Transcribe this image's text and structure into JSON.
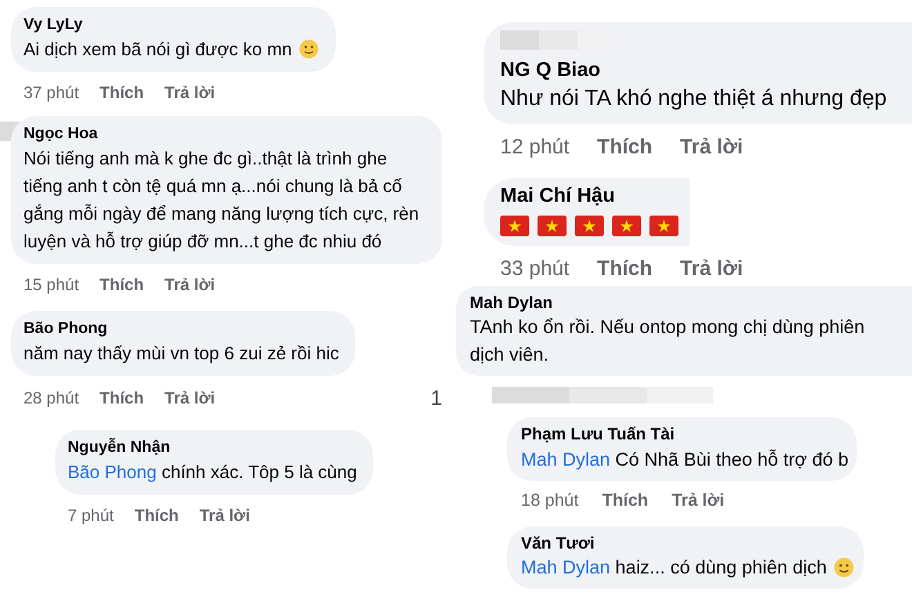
{
  "panels": [
    {
      "comments": [
        {
          "kind": "comment",
          "author": "Vy LyLy",
          "text": "Ai dịch xem bã nói gì được ko mn",
          "emoji": true,
          "time": "37 phút",
          "like": "Thích",
          "reply": "Trả lời"
        },
        {
          "kind": "comment",
          "author": "Ngọc Hoa",
          "text": "Nói tiếng anh mà k ghe đc gì..thật là trình ghe tiếng anh t còn tệ quá mn ạ...nói chung là bả cố gắng mỗi ngày để mang năng lượng tích cực, rèn luyện và hỗ trợ giúp đỡ mn...t ghe đc nhiu đó",
          "time": "15 phút",
          "like": "Thích",
          "reply": "Trả lời"
        },
        {
          "kind": "comment",
          "author": "Bão Phong",
          "text": "năm nay thấy mùi vn top 6 zui zẻ rồi hic",
          "time": "28 phút",
          "like": "Thích",
          "reply": "Trả lời",
          "side_note": "1"
        },
        {
          "kind": "reply",
          "author": "Nguyễn Nhận",
          "mention": "Bão Phong",
          "text": "chính xác. Tôp 5 là cùng",
          "time": "7 phút",
          "like": "Thích",
          "reply": "Trả lời"
        }
      ]
    },
    {
      "comments": [
        {
          "kind": "comment",
          "author": "NG Q Biao",
          "text": "Như nói TA khó nghe thiệt á nhưng đẹp",
          "time": "12 phút",
          "like": "Thích",
          "reply": "Trả lời"
        },
        {
          "kind": "flags",
          "author": "Mai Chí Hậu",
          "time": "33 phút",
          "like": "Thích",
          "reply": "Trả lời"
        }
      ]
    },
    {
      "comments": [
        {
          "kind": "comment",
          "author": "Mah Dylan",
          "text": "TAnh ko ổn rồi. Nếu ontop mong chị dùng phiên dịch viên."
        },
        {
          "kind": "reply",
          "author": "Phạm Lưu Tuấn Tài",
          "mention": "Mah Dylan",
          "text": "Có Nhã Bùi theo hỗ trợ đó b",
          "time": "18 phút",
          "like": "Thích",
          "reply": "Trả lời"
        },
        {
          "kind": "reply",
          "author": "Văn Tươi",
          "mention": "Mah Dylan",
          "text": "haiz... có dùng phiên dịch",
          "emoji": true
        }
      ]
    }
  ]
}
